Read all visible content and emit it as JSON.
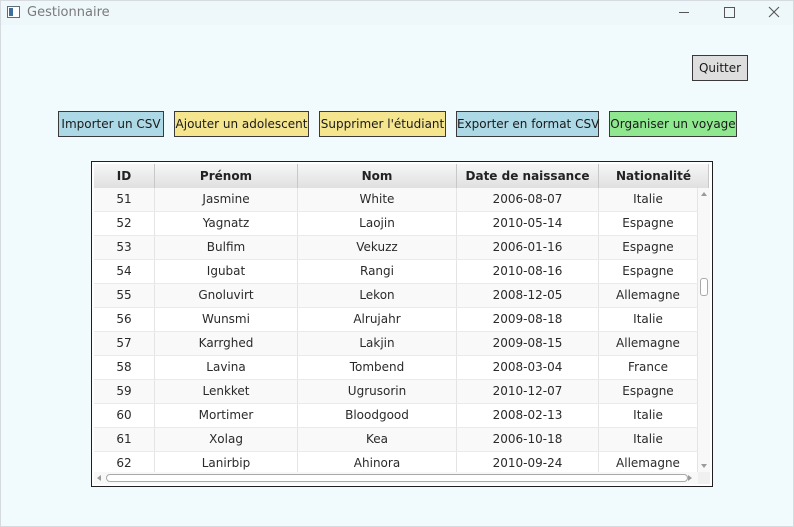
{
  "window": {
    "title": "Gestionnaire",
    "controls": [
      "minimize",
      "maximize",
      "close"
    ]
  },
  "toolbar": {
    "quit_label": "Quitter",
    "import_label": "Importer un CSV",
    "add_label": "Ajouter un adolescent",
    "delete_label": "Supprimer l'étudiant",
    "export_label": "Exporter en format CSV",
    "trip_label": "Organiser un voyage"
  },
  "colors": {
    "window_bg": "#f1fbfd",
    "button_blue": "#add8e6",
    "button_yellow": "#f5e58f",
    "button_green": "#8fe88f",
    "button_grey": "#dedede"
  },
  "table": {
    "columns": [
      "ID",
      "Prénom",
      "Nom",
      "Date de naissance",
      "Nationalité"
    ],
    "rows": [
      [
        "51",
        "Jasmine",
        "White",
        "2006-08-07",
        "Italie"
      ],
      [
        "52",
        "Yagnatz",
        "Laojin",
        "2010-05-14",
        "Espagne"
      ],
      [
        "53",
        "Bulfim",
        "Vekuzz",
        "2006-01-16",
        "Espagne"
      ],
      [
        "54",
        "Igubat",
        "Rangi",
        "2010-08-16",
        "Espagne"
      ],
      [
        "55",
        "Gnoluvirt",
        "Lekon",
        "2008-12-05",
        "Allemagne"
      ],
      [
        "56",
        "Wunsmi",
        "Alrujahr",
        "2009-08-18",
        "Italie"
      ],
      [
        "57",
        "Karrghed",
        "Lakjin",
        "2009-08-15",
        "Allemagne"
      ],
      [
        "58",
        "Lavina",
        "Tombend",
        "2008-03-04",
        "France"
      ],
      [
        "59",
        "Lenkket",
        "Ugrusorin",
        "2010-12-07",
        "Espagne"
      ],
      [
        "60",
        "Mortimer",
        "Bloodgood",
        "2008-02-13",
        "Italie"
      ],
      [
        "61",
        "Xolag",
        "Kea",
        "2006-10-18",
        "Italie"
      ],
      [
        "62",
        "Lanirbip",
        "Ahinora",
        "2010-09-24",
        "Allemagne"
      ]
    ]
  }
}
